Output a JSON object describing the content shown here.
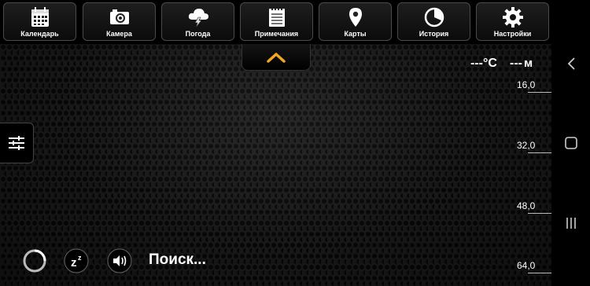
{
  "tabs": [
    {
      "label": "Календарь",
      "icon": "calendar-icon"
    },
    {
      "label": "Камера",
      "icon": "camera-icon"
    },
    {
      "label": "Погода",
      "icon": "weather-icon"
    },
    {
      "label": "Примечания",
      "icon": "notes-icon"
    },
    {
      "label": "Карты",
      "icon": "map-pin-icon"
    },
    {
      "label": "История",
      "icon": "history-icon"
    },
    {
      "label": "Настройки",
      "icon": "settings-gear-icon"
    }
  ],
  "readouts": {
    "temperature": "---°C",
    "distance_value": "---",
    "distance_unit": "м"
  },
  "scale": {
    "ticks": [
      "16,0",
      "32,0",
      "48,0",
      "64,0"
    ]
  },
  "status": {
    "text": "Поиск..."
  },
  "colors": {
    "accent": "#f5a623",
    "background": "#1b1b1b"
  }
}
